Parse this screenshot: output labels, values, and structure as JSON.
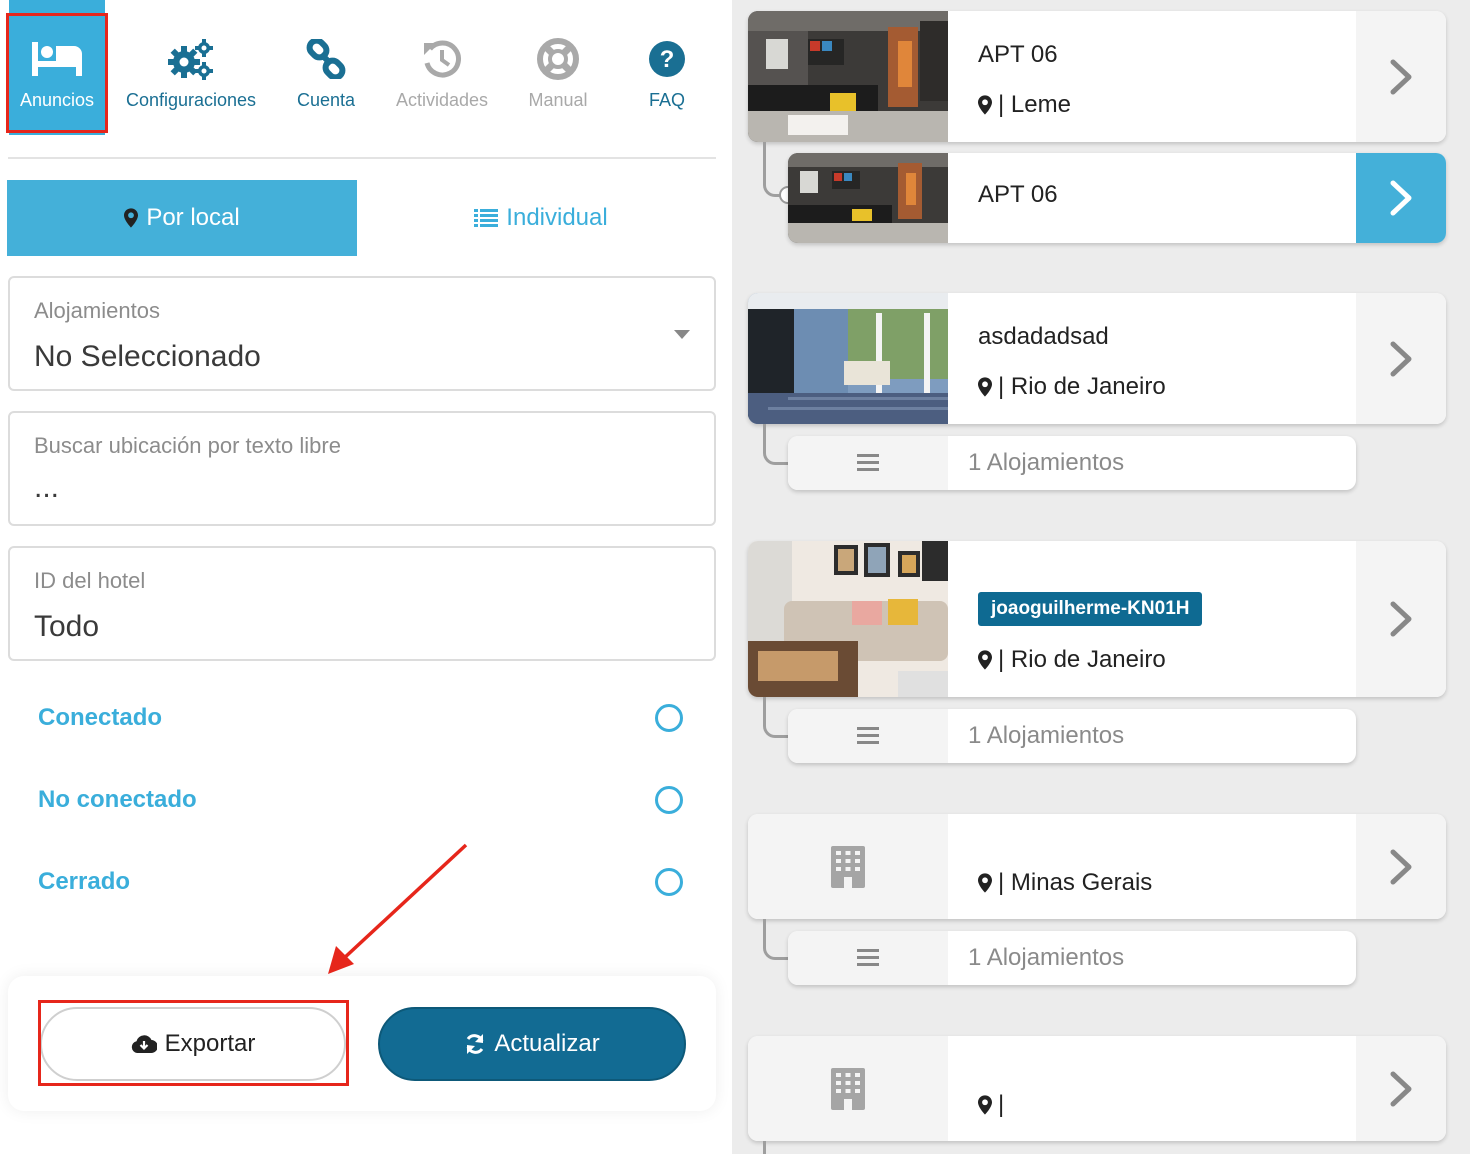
{
  "nav": {
    "items": [
      {
        "label": "Anuncios",
        "icon": "bed-icon",
        "state": "active"
      },
      {
        "label": "Configuraciones",
        "icon": "gears-icon",
        "state": "enabled"
      },
      {
        "label": "Cuenta",
        "icon": "link-icon",
        "state": "enabled"
      },
      {
        "label": "Actividades",
        "icon": "history-icon",
        "state": "disabled"
      },
      {
        "label": "Manual",
        "icon": "lifebuoy-icon",
        "state": "disabled"
      },
      {
        "label": "FAQ",
        "icon": "question-icon",
        "state": "enabled"
      }
    ]
  },
  "mode_toggle": {
    "local_label": "Por local",
    "individual_label": "Individual",
    "selected": "Por local"
  },
  "filters": {
    "accommodations": {
      "label": "Alojamientos",
      "value": "No Seleccionado"
    },
    "search": {
      "label": "Buscar ubicación por texto libre",
      "value": "..."
    },
    "hotel_id": {
      "label": "ID del hotel",
      "value": "Todo"
    }
  },
  "status_options": [
    {
      "label": "Conectado",
      "checked": false
    },
    {
      "label": "No conectado",
      "checked": false
    },
    {
      "label": "Cerrado",
      "checked": false
    }
  ],
  "actions": {
    "export_label": "Exportar",
    "update_label": "Actualizar"
  },
  "listings": [
    {
      "title": "APT 06",
      "location": "| Leme",
      "thumb": "living-room-photo"
    },
    {
      "title": "APT 06",
      "thumb": "living-room-photo",
      "selected": true
    },
    {
      "title": "asdadadsad",
      "location": "| Rio de Janeiro",
      "thumb": "porch-photo",
      "sub_label": "1 Alojamientos"
    },
    {
      "tag": "joaoguilherme-KN01H",
      "location": "| Rio de Janeiro",
      "thumb": "sofa-photo",
      "sub_label": "1 Alojamientos"
    },
    {
      "location": "| Minas Gerais",
      "thumb": "building-icon",
      "sub_label": "1 Alojamientos"
    },
    {
      "location": "|",
      "thumb": "building-icon"
    }
  ],
  "colors": {
    "accent": "#44b0d9",
    "primary_dark": "#126b93",
    "highlight_red": "#e6261b",
    "panel_gray": "#ececec"
  }
}
